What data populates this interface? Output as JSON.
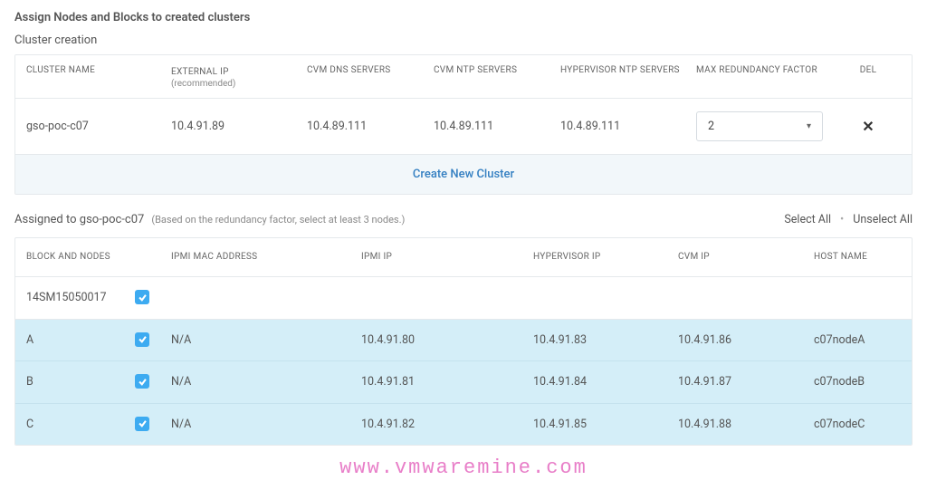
{
  "title": "Assign Nodes and Blocks to created clusters",
  "cluster_section": {
    "title": "Cluster creation",
    "headers": {
      "name": "CLUSTER NAME",
      "external_ip": "EXTERNAL IP",
      "external_ip_sub": "(recommended)",
      "cvm_dns": "CVM DNS SERVERS",
      "cvm_ntp": "CVM NTP SERVERS",
      "hyp_ntp": "HYPERVISOR NTP SERVERS",
      "redundancy": "MAX REDUNDANCY FACTOR",
      "del": "DEL"
    },
    "row": {
      "name": "gso-poc-c07",
      "external_ip": "10.4.91.89",
      "cvm_dns": "10.4.89.111",
      "cvm_ntp": "10.4.89.111",
      "hyp_ntp": "10.4.89.111",
      "redundancy": "2"
    },
    "create_label": "Create New Cluster"
  },
  "assigned": {
    "prefix": "Assigned to",
    "cluster": "gso-poc-c07",
    "hint": "(Based on the redundancy factor, select at least 3 nodes.)",
    "select_all": "Select All",
    "unselect_all": "Unselect All"
  },
  "nodes": {
    "headers": {
      "block": "BLOCK AND NODES",
      "ipmi_mac": "IPMI MAC ADDRESS",
      "ipmi_ip": "IPMI IP",
      "hyp_ip": "HYPERVISOR IP",
      "cvm_ip": "CVM IP",
      "host": "HOST NAME"
    },
    "block_id": "14SM15050017",
    "rows": [
      {
        "label": "A",
        "ipmi_mac": "N/A",
        "ipmi_ip": "10.4.91.80",
        "hyp_ip": "10.4.91.83",
        "cvm_ip": "10.4.91.86",
        "host": "c07nodeA"
      },
      {
        "label": "B",
        "ipmi_mac": "N/A",
        "ipmi_ip": "10.4.91.81",
        "hyp_ip": "10.4.91.84",
        "cvm_ip": "10.4.91.87",
        "host": "c07nodeB"
      },
      {
        "label": "C",
        "ipmi_mac": "N/A",
        "ipmi_ip": "10.4.91.82",
        "hyp_ip": "10.4.91.85",
        "cvm_ip": "10.4.91.88",
        "host": "c07nodeC"
      }
    ]
  },
  "watermark": "www.vmwaremine.com"
}
